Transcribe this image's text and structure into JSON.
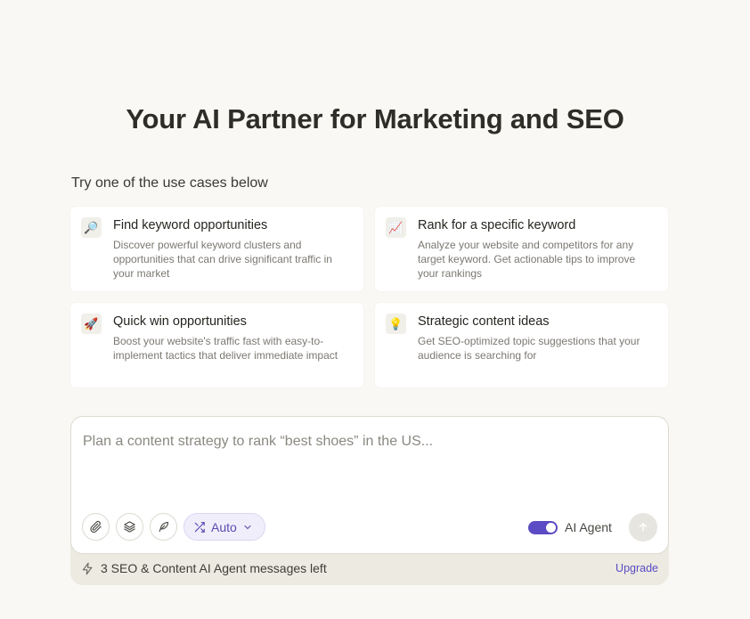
{
  "hero": {
    "title": "Your AI Partner for Marketing and SEO"
  },
  "use_cases": {
    "label": "Try one of the use cases below",
    "items": [
      {
        "icon": "magnifying-glass-icon",
        "glyph": "🔎",
        "title": "Find keyword opportunities",
        "description": "Discover powerful keyword clusters and opportunities that can drive significant traffic in your market"
      },
      {
        "icon": "chart-increasing-icon",
        "glyph": "📈",
        "title": "Rank for a specific keyword",
        "description": "Analyze your website and competitors for any target keyword. Get actionable tips to improve your rankings"
      },
      {
        "icon": "rocket-icon",
        "glyph": "🚀",
        "title": "Quick win opportunities",
        "description": "Boost your website's traffic fast with easy-to-implement tactics that deliver immediate impact"
      },
      {
        "icon": "light-bulb-icon",
        "glyph": "💡",
        "title": "Strategic content ideas",
        "description": "Get SEO-optimized topic suggestions that your audience is searching for"
      }
    ]
  },
  "composer": {
    "placeholder": "Plan a content strategy to rank “best shoes” in the US...",
    "mode_label": "Auto",
    "agent_label": "AI Agent",
    "agent_enabled": true,
    "messages_left": "3 SEO & Content AI Agent messages left",
    "upgrade_label": "Upgrade"
  },
  "colors": {
    "background": "#f9f8f4",
    "accent": "#5b4bc4",
    "card": "#ffffff",
    "footer": "#eceae1"
  }
}
